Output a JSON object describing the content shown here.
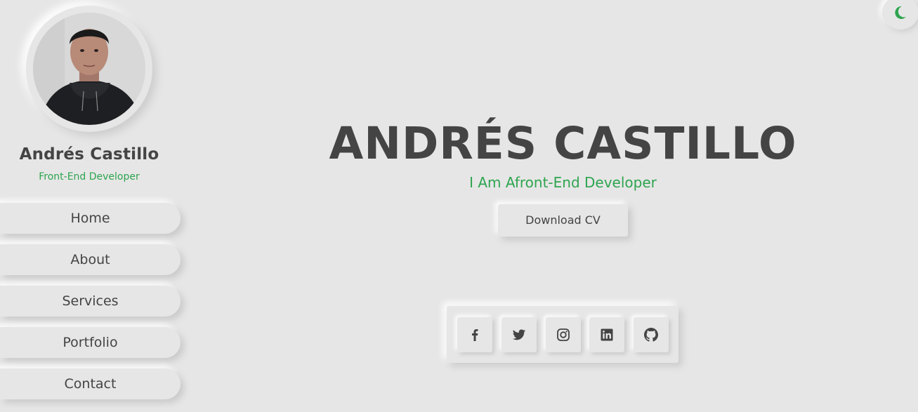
{
  "theme": {
    "accent_color": "#2ea44f",
    "text_color": "#444444",
    "background_color": "#e6e6e6",
    "toggle_icon": "moon-icon"
  },
  "sidebar": {
    "avatar_description": "profile-photo",
    "name": "Andrés Castillo",
    "role": "Front-End Developer",
    "nav": [
      {
        "label": "Home"
      },
      {
        "label": "About"
      },
      {
        "label": "Services"
      },
      {
        "label": "Portfolio"
      },
      {
        "label": "Contact"
      }
    ]
  },
  "hero": {
    "title": "ANDRÉS CASTILLO",
    "subtitle": "I Am Afront-End Developer",
    "download_label": "Download CV"
  },
  "social": {
    "icons": [
      "facebook-icon",
      "twitter-icon",
      "instagram-icon",
      "linkedin-icon",
      "github-icon"
    ]
  }
}
